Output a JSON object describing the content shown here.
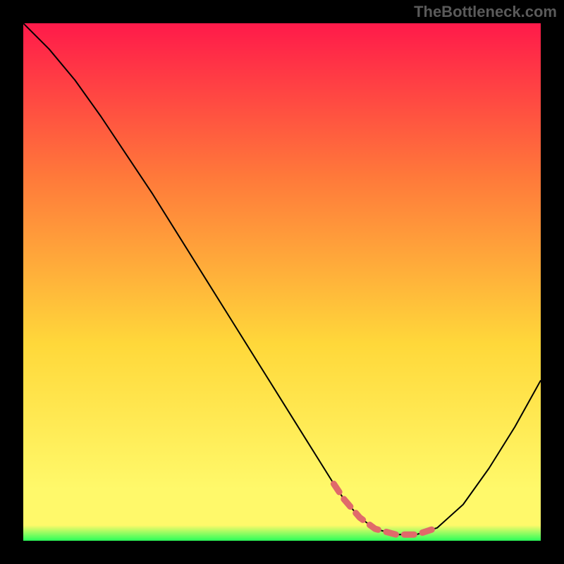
{
  "watermark": "TheBottleneck.com",
  "chart_data": {
    "type": "line",
    "title": "",
    "xlabel": "",
    "ylabel": "",
    "xlim": [
      0,
      100
    ],
    "ylim": [
      0,
      100
    ],
    "gradient_colors": {
      "top": "#ff1a4a",
      "mid_upper": "#ff7a3a",
      "mid": "#ffd83a",
      "mid_lower": "#fff96a",
      "bottom": "#2aff5a"
    },
    "curve": {
      "color": "#000000",
      "width": 2,
      "x": [
        0,
        5,
        10,
        15,
        20,
        25,
        30,
        35,
        40,
        45,
        50,
        55,
        60,
        62,
        65,
        68,
        72,
        76,
        80,
        85,
        90,
        95,
        100
      ],
      "y": [
        100,
        95,
        89,
        82,
        74.5,
        67,
        59,
        51,
        43,
        35,
        27,
        19,
        11,
        8,
        4.5,
        2.3,
        1.2,
        1.2,
        2.5,
        7,
        14,
        22,
        31
      ]
    },
    "highlight_band": {
      "color": "#e06a6a",
      "width": 9,
      "x": [
        60,
        62,
        65,
        68,
        72,
        76,
        80
      ],
      "y": [
        11,
        8,
        4.5,
        2.3,
        1.2,
        1.2,
        2.5
      ]
    }
  }
}
